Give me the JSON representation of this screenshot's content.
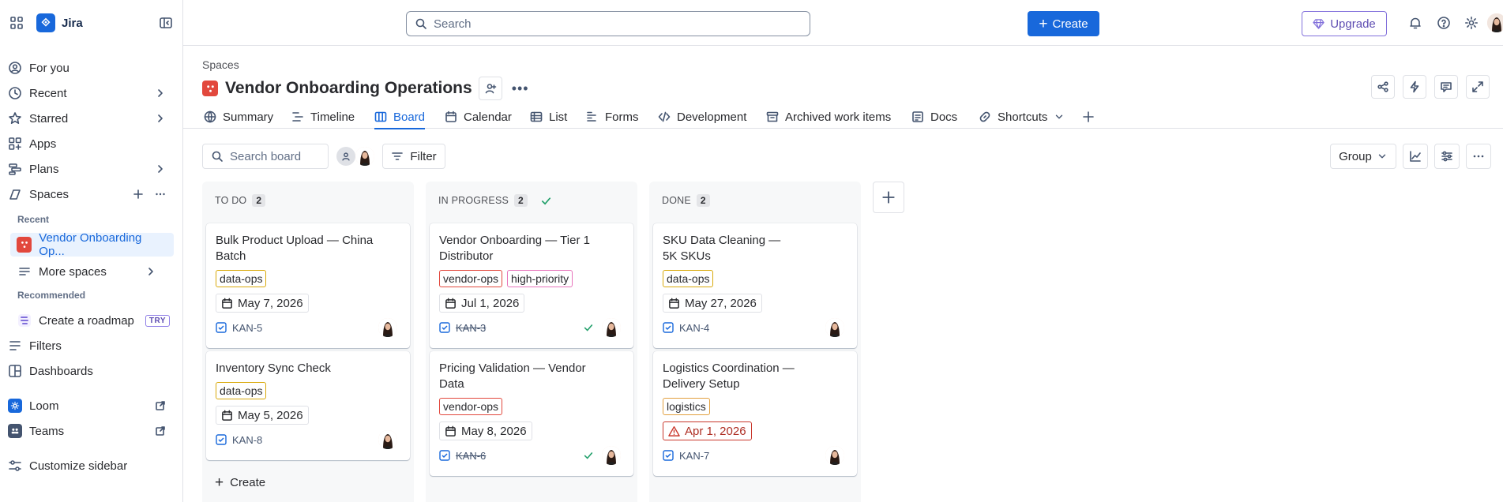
{
  "app": {
    "name": "Jira"
  },
  "sidebar": {
    "items": [
      {
        "label": "For you"
      },
      {
        "label": "Recent"
      },
      {
        "label": "Starred"
      },
      {
        "label": "Apps"
      },
      {
        "label": "Plans"
      },
      {
        "label": "Spaces"
      }
    ],
    "recent_heading": "Recent",
    "recent_space": "Vendor Onboarding Op...",
    "more_spaces": "More spaces",
    "recommended_heading": "Recommended",
    "create_roadmap": "Create a roadmap",
    "try_badge": "TRY",
    "filters": "Filters",
    "dashboards": "Dashboards",
    "loom": "Loom",
    "teams": "Teams",
    "customize": "Customize sidebar"
  },
  "topbar": {
    "search_placeholder": "Search",
    "create_label": "Create",
    "upgrade_label": "Upgrade"
  },
  "header": {
    "breadcrumb": "Spaces",
    "title": "Vendor Onboarding Operations"
  },
  "tabs": [
    {
      "label": "Summary"
    },
    {
      "label": "Timeline"
    },
    {
      "label": "Board"
    },
    {
      "label": "Calendar"
    },
    {
      "label": "List"
    },
    {
      "label": "Forms"
    },
    {
      "label": "Development"
    },
    {
      "label": "Archived work items"
    },
    {
      "label": "Docs"
    },
    {
      "label": "Shortcuts"
    }
  ],
  "toolbar": {
    "search_placeholder": "Search board",
    "filter_label": "Filter",
    "group_label": "Group"
  },
  "columns": [
    {
      "title": "TO DO",
      "count": "2",
      "create_label": "Create",
      "cards": [
        {
          "title": "Bulk Product Upload — China Batch",
          "labels": [
            "data-ops"
          ],
          "date": "May 7, 2026",
          "key": "KAN-5"
        },
        {
          "title": "Inventory Sync Check",
          "labels": [
            "data-ops"
          ],
          "date": "May 5, 2026",
          "key": "KAN-8"
        }
      ]
    },
    {
      "title": "IN PROGRESS",
      "count": "2",
      "cards": [
        {
          "title": "Vendor Onboarding — Tier 1 Distributor",
          "labels": [
            "vendor-ops",
            "high-priority"
          ],
          "date": "Jul 1, 2026",
          "key": "KAN-3"
        },
        {
          "title": "Pricing Validation — Vendor Data",
          "labels": [
            "vendor-ops"
          ],
          "date": "May 8, 2026",
          "key": "KAN-6"
        }
      ]
    },
    {
      "title": "DONE",
      "count": "2",
      "cards": [
        {
          "title": "SKU Data Cleaning — 5K SKUs",
          "labels": [
            "data-ops"
          ],
          "date": "May 27, 2026",
          "key": "KAN-4"
        },
        {
          "title": "Logistics Coordination — Delivery Setup",
          "labels": [
            "logistics"
          ],
          "date": "Apr 1, 2026",
          "key": "KAN-7"
        }
      ]
    }
  ],
  "colors": {
    "accent": "#1868db",
    "overdue": "#c9372c",
    "upgrade": "#5e4db2",
    "space_icon": "#e2483d"
  }
}
